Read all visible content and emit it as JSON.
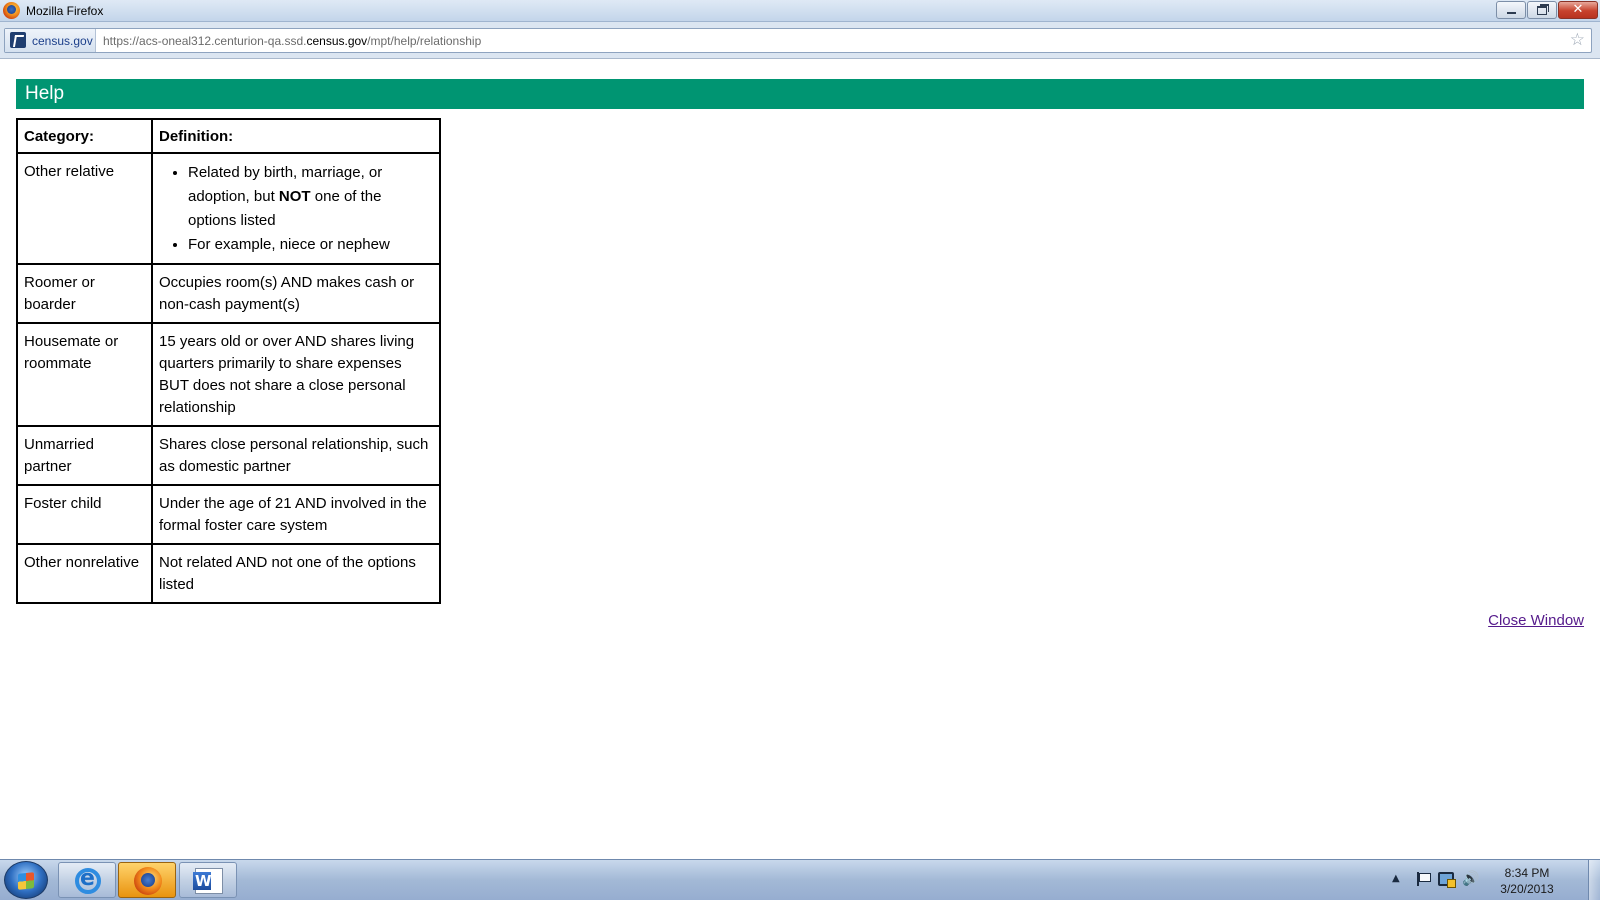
{
  "window": {
    "title": "Mozilla Firefox"
  },
  "addressbar": {
    "site_identity": "census.gov",
    "url_prefix": "https://acs-oneal312.centurion-qa.ssd.",
    "url_domain": "census.gov",
    "url_path": "/mpt/help/relationship"
  },
  "page": {
    "header_title": "Help",
    "table": {
      "headers": [
        "Category:",
        "Definition:"
      ],
      "rows": [
        {
          "category": "Other relative",
          "bullets": [
            {
              "pre": "Related by birth, marriage, or adoption, but ",
              "strong": "NOT",
              "post": " one of the options listed"
            },
            {
              "text": "For example, niece or nephew"
            }
          ]
        },
        {
          "category": "Roomer or boarder",
          "definition": "Occupies room(s) AND makes cash or non-cash payment(s)"
        },
        {
          "category": "Housemate or roommate",
          "definition": "15 years old or over AND shares living quarters primarily to share expenses BUT does not share a close personal relationship"
        },
        {
          "category": "Unmarried partner",
          "definition": "Shares close personal relationship, such as domestic partner"
        },
        {
          "category": "Foster child",
          "definition": "Under the age of 21 AND involved in the formal foster care system"
        },
        {
          "category": "Other nonrelative",
          "definition": "Not related AND not one of the options listed"
        }
      ]
    },
    "close_link": "Close Window"
  },
  "taskbar": {
    "apps": [
      "internet-explorer",
      "firefox",
      "word"
    ],
    "tray": {
      "time": "8:34 PM",
      "date": "3/20/2013",
      "up_arrow": "▲",
      "volume_glyph": "🔊"
    }
  },
  "glyphs": {
    "close": "✕",
    "star": "☆"
  },
  "colors": {
    "header_green": "#009572",
    "link_visited": "#551a8b"
  }
}
